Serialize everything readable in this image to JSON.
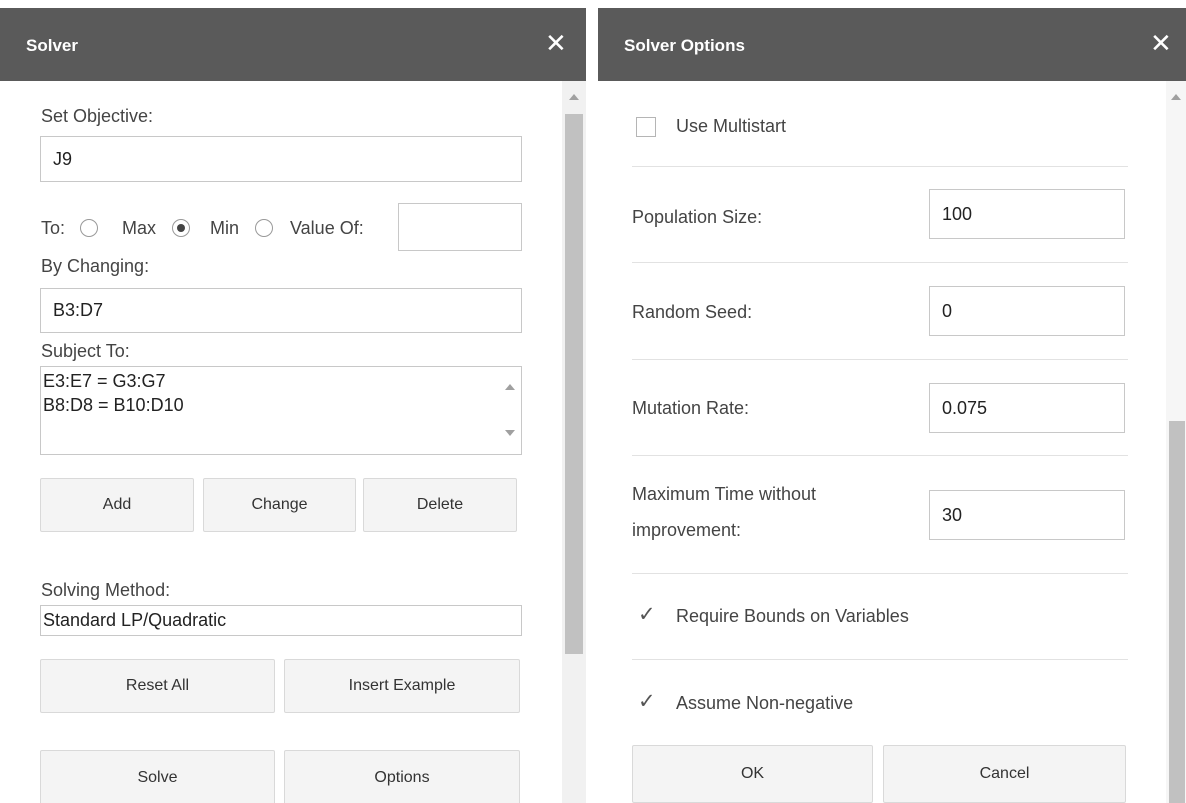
{
  "solver": {
    "title": "Solver",
    "close": "✕",
    "set_objective_label": "Set Objective:",
    "objective_value": "J9",
    "to_label": "To:",
    "options": {
      "max": "Max",
      "min": "Min",
      "value_of": "Value Of:"
    },
    "selected_option": "Min",
    "value_of_input": "",
    "by_changing_label": "By Changing:",
    "by_changing_value": "B3:D7",
    "subject_to_label": "Subject To:",
    "constraints": [
      "E3:E7 = G3:G7",
      "B8:D8 = B10:D10"
    ],
    "add_label": "Add",
    "change_label": "Change",
    "delete_label": "Delete",
    "solving_method_label": "Solving Method:",
    "solving_method_value": "Standard LP/Quadratic",
    "reset_label": "Reset All",
    "insert_example_label": "Insert Example",
    "solve_label": "Solve",
    "options_label": "Options"
  },
  "options_dialog": {
    "title": "Solver Options",
    "close": "✕",
    "use_multistart_label": "Use Multistart",
    "use_multistart_checked": false,
    "population_size_label": "Population Size:",
    "population_size_value": "100",
    "random_seed_label": "Random Seed:",
    "random_seed_value": "0",
    "mutation_rate_label": "Mutation Rate:",
    "mutation_rate_value": "0.075",
    "max_time_label_line1": "Maximum Time without",
    "max_time_label_line2": "improvement:",
    "max_time_value": "30",
    "require_bounds_label": "Require Bounds on Variables",
    "require_bounds_checked": true,
    "assume_nonneg_label": "Assume Non-negative",
    "assume_nonneg_checked": true,
    "ok_label": "OK",
    "cancel_label": "Cancel"
  }
}
